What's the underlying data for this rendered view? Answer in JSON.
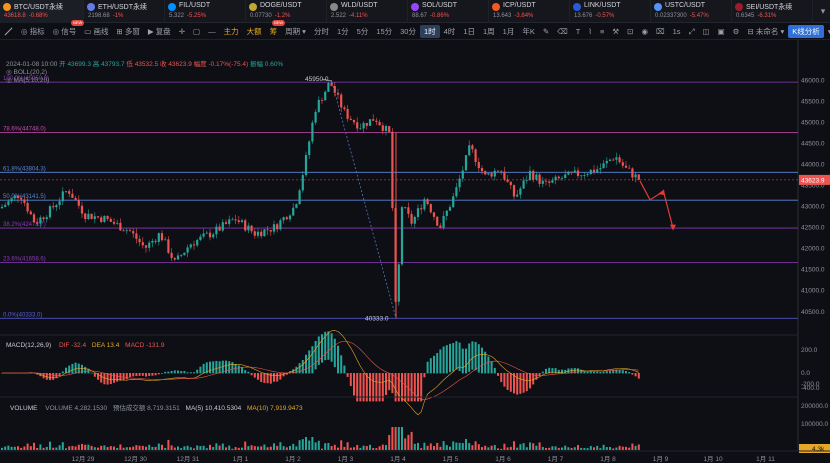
{
  "tickers": [
    {
      "symbol": "BTC/USDT永续",
      "price": "43618.8",
      "change": "-0.68%",
      "color": "#f7931a"
    },
    {
      "symbol": "ETH/USDT永续",
      "price": "2198.68",
      "change": "-1%",
      "color": "#627eea"
    },
    {
      "symbol": "FIL/USDT",
      "price": "5.322",
      "change": "-5.25%",
      "color": "#0090ff"
    },
    {
      "symbol": "DOGE/USDT",
      "price": "0.07730",
      "change": "-1.2%",
      "color": "#c2a633"
    },
    {
      "symbol": "WLD/USDT",
      "price": "2.522",
      "change": "-4.11%",
      "color": "#888888"
    },
    {
      "symbol": "SOL/USDT",
      "price": "88.67",
      "change": "-0.86%",
      "color": "#9945ff"
    },
    {
      "symbol": "ICP/USDT",
      "price": "13.643",
      "change": "-3.84%",
      "color": "#f15a24"
    },
    {
      "symbol": "LINK/USDT",
      "price": "13.676",
      "change": "-0.57%",
      "color": "#2a5ada"
    },
    {
      "symbol": "USTC/USDT",
      "price": "0.02337300",
      "change": "-5.47%",
      "color": "#5493f7"
    },
    {
      "symbol": "SEI/USDT永续",
      "price": "0.6345",
      "change": "-6.31%",
      "color": "#9b1c2e"
    }
  ],
  "toolbar": {
    "indicators": "指标",
    "signal": "信号",
    "layout": "画线",
    "multi": "多窗",
    "replay": "复盘",
    "main_force": "主力",
    "big_order": "大额",
    "chip": "筹",
    "period": "周期",
    "intervals": [
      "分时",
      "1分",
      "5分",
      "15分",
      "30分",
      "1时",
      "4时",
      "1日",
      "1周",
      "1月",
      "年K"
    ],
    "active_interval": "1时",
    "speed": "1s",
    "unnamed": "未命名",
    "ai": "K线分析",
    "new_badge": "NEW"
  },
  "info": {
    "datetime": "2024-01-08 10:00",
    "open": "开 43699.3",
    "high": "高 43793.7",
    "low": "低 43532.5",
    "close": "收 43623.9",
    "change": "幅度 -0.17%(-75.4)",
    "amplitude": "振幅 0.60%",
    "boll": "BOLL(20,2)",
    "ma": "MA(5,10,20)"
  },
  "fib": [
    {
      "label": "100.0%(45950.0)",
      "level": 45950.0,
      "color": "#8c3ab8"
    },
    {
      "label": "78.6%(44748.0)",
      "level": 44748.0,
      "color": "#c94ab0"
    },
    {
      "label": "61.8%(43804.3)",
      "level": 43804.3,
      "color": "#5a86d8"
    },
    {
      "label": "50.0%(43141.5)",
      "level": 43141.5,
      "color": "#5a86d8"
    },
    {
      "label": "38.2%(42478.7)",
      "level": 42478.7,
      "color": "#8c3ab8"
    },
    {
      "label": "23.6%(41658.6)",
      "level": 41658.6,
      "color": "#8c3ab8"
    },
    {
      "label": "0.0%(40333.0)",
      "level": 40333.0,
      "color": "#5a5fe0"
    }
  ],
  "annotations": {
    "high_label": "45950.0",
    "low_label": "40333.0",
    "current_price": "43623.9"
  },
  "price_axis": [
    "46000.0",
    "45500.0",
    "45000.0",
    "44500.0",
    "44000.0",
    "43500.0",
    "43000.0",
    "42500.0",
    "42000.0",
    "41500.0",
    "41000.0",
    "40500.0"
  ],
  "macd": {
    "title": "MACD(12,26,9)",
    "dif": "DIF -32.4",
    "dea": "DEA 13.4",
    "macd": "MACD -131.9",
    "axis": [
      "200.0",
      "0.0",
      "-200.0",
      "-400.0"
    ]
  },
  "volume": {
    "title": "VOLUME",
    "vol": "VOLUME 4,282.1530",
    "forecast": "预估成交额 8,719.3151",
    "ma5": "MA(5) 10,410.5304",
    "ma10": "MA(10) 7,919.9473",
    "axis": [
      "200000.0",
      "100000.0"
    ],
    "current": "4.3k"
  },
  "time_axis": [
    "12月 29",
    "12月 30",
    "12月 31",
    "1月 1",
    "1月 2",
    "1月 3",
    "1月 4",
    "1月 5",
    "1月 6",
    "1月 7",
    "1月 8",
    "1月 9",
    "1月 10",
    "1月 11"
  ],
  "colors": {
    "up": "#26a69a",
    "down": "#ef5350",
    "bg": "#0e0f14"
  }
}
